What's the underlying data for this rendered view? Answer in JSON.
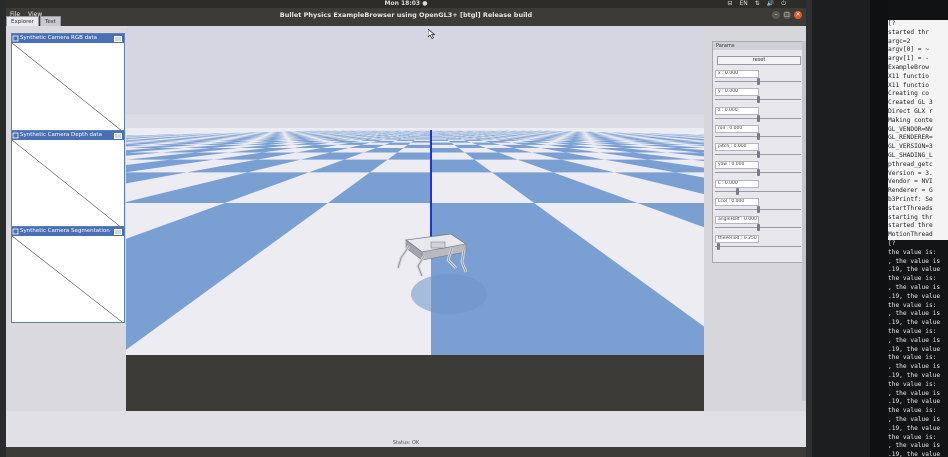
{
  "topbar": {
    "clock": "Mon 18:03 ●",
    "indicators": [
      "⊟",
      "EN",
      "⇅",
      "🔊",
      "⏻"
    ]
  },
  "window": {
    "title": "Bullet Physics ExampleBrowser using OpenGL3+ [btgl] Release build",
    "menus": [
      "File",
      "View"
    ],
    "buttons": [
      "–",
      "□",
      "✕"
    ]
  },
  "tabs": [
    "Explorer",
    "Test"
  ],
  "camera_windows": [
    {
      "title": "Synthetic Camera RGB data"
    },
    {
      "title": "Synthetic Camera Depth data"
    },
    {
      "title": "Synthetic Camera Segmentation Mask"
    }
  ],
  "params": {
    "title": "Params",
    "reset_label": "reset",
    "sliders": [
      {
        "label": "x : 0.000",
        "level": 0.5
      },
      {
        "label": "y : 0.000",
        "level": 0.5
      },
      {
        "label": "z : 0.000",
        "level": 0.5
      },
      {
        "label": "roll : 0.000",
        "level": 0.5
      },
      {
        "label": "pitch : 0.000",
        "level": 0.5
      },
      {
        "label": "yaw : 0.000",
        "level": 0.5
      },
      {
        "label": "L : 0.000",
        "level": 0.25
      },
      {
        "label": "Lcol : 0.000",
        "level": 0.5
      },
      {
        "label": "angleHalt : 0.000",
        "level": 0.5
      },
      {
        "label": "thePeriod : 0.250",
        "level": 0.03
      }
    ]
  },
  "status": "Status: OK",
  "terminal": {
    "top_lines": [
      "[?",
      "started thr",
      "argc=2",
      "argv[0] = ~",
      "argv[1] = -",
      "ExampleBrow",
      "X11 functio",
      "X11 functio",
      "Creating co",
      "Created GL 3",
      "Direct GLX r",
      "Making conte",
      "GL_VENDOR=NV",
      "GL_RENDERER=",
      "GL_VERSION=3",
      "GL_SHADING_L",
      "pthread_getc",
      "Version = 3.",
      "Vendor = NVI",
      "Renderer = G",
      "b3Printf: Se",
      "startThreads",
      "starting thr",
      "started thre",
      "MotionThread",
      "ven = NVIDIA",
      "ven = NVIDIA",
      "current path"
    ],
    "bottom_lines": [
      "[?",
      "the value is:",
      ", the value is",
      ".19, the value",
      "the value is:",
      ", the value is",
      ".19, the value",
      "the value is:",
      ", the value is",
      ".19, the value",
      "the value is:",
      ", the value is",
      ".19, the value",
      "the value is:",
      ", the value is",
      ".19, the value",
      "the value is:",
      ", the value is",
      ".19, the value",
      "the value is:",
      ", the value is",
      ".19, the value",
      "the value is:",
      ", the value is",
      ".19, the value",
      "the value is:",
      ", the value is"
    ]
  },
  "colors": {
    "sky": "#d6d6e3",
    "floor_blue": "#7a9fd3",
    "floor_light": "#ececf2",
    "axis_blue": "#2233d6",
    "panel_header": "#4a6fb6"
  },
  "icons": {
    "cursor": "arrow-cursor-icon"
  }
}
